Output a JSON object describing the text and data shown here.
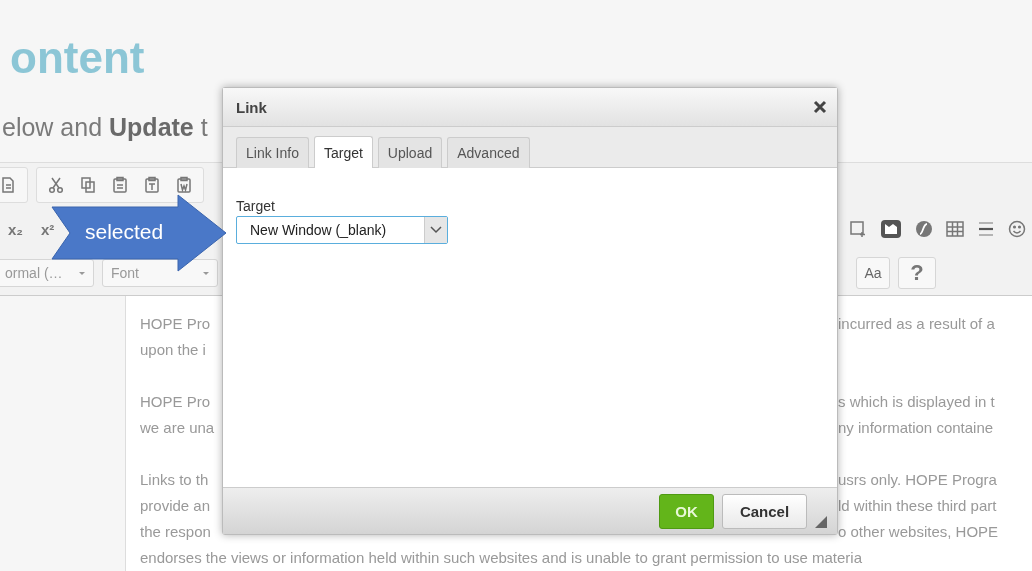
{
  "page": {
    "heading": "ontent",
    "subtitle": "elow and **Update** t"
  },
  "toolbar": {
    "script_buttons": [
      "x₂",
      "x²"
    ],
    "dropdowns": [
      {
        "value": "ormal (…"
      },
      {
        "value": "Font"
      }
    ],
    "buttons": [
      "Aa",
      "?"
    ]
  },
  "editor": {
    "paragraphs": [
      {
        "lines": [
          {
            "left": "HOPE Pro",
            "right": "incurred as a result of a"
          },
          {
            "left": "upon the i"
          }
        ]
      },
      {
        "lines": [
          {
            "left": "HOPE Pro",
            "right": "s which is displayed in t"
          },
          {
            "left": "we are una",
            "right": "ny information containe"
          }
        ]
      },
      {
        "lines": [
          {
            "left": "Links to th",
            "right": "usrs only. HOPE Progra"
          },
          {
            "left": "provide an",
            "right": "ld within these third part"
          },
          {
            "left": "the respon",
            "right": "o other websites, HOPE"
          },
          {
            "left": "endorses the views or information held within such websites and is unable to grant permission to use materia"
          }
        ]
      }
    ]
  },
  "dialog": {
    "title": "Link",
    "tabs": [
      {
        "label": "Link Info",
        "selected": false
      },
      {
        "label": "Target",
        "selected": true
      },
      {
        "label": "Upload",
        "selected": false
      },
      {
        "label": "Advanced",
        "selected": false
      }
    ],
    "field": {
      "label": "Target",
      "value": "New Window (_blank)"
    },
    "buttons": [
      {
        "label": "OK",
        "kind": "primary"
      },
      {
        "label": "Cancel",
        "kind": "secondary"
      }
    ]
  },
  "callout": {
    "text": "selected"
  }
}
